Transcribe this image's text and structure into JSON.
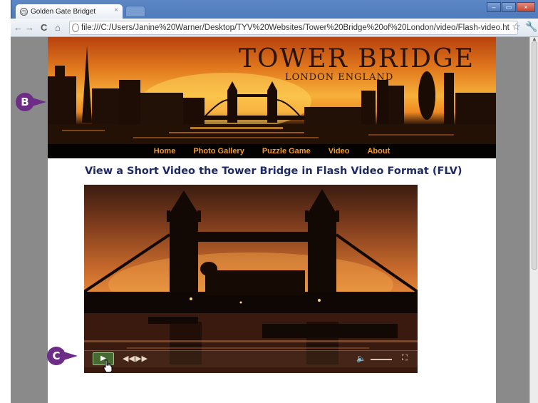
{
  "browser": {
    "tab_title": "Golden Gate Bridget",
    "tab_close": "×",
    "url": "file:///C:/Users/Janine%20Warner/Desktop/TYV%20Websites/Tower%20Bridge%20of%20London/video/Flash-video.ht",
    "window_buttons": {
      "minimize": "–",
      "maximize": "▭",
      "close": "×"
    },
    "icons": {
      "back": "back-arrow-icon",
      "forward": "forward-arrow-icon",
      "reload": "reload-icon",
      "home": "home-icon",
      "bookmark": "star-icon",
      "settings": "wrench-icon"
    }
  },
  "site": {
    "banner_title": "TOWER BRIDGE",
    "banner_subtitle": "LONDON ENGLAND",
    "nav": [
      "Home",
      "Photo Gallery",
      "Puzzle Game",
      "Video",
      "About"
    ],
    "heading": "View a Short Video the Tower Bridge in Flash Video Format (FLV)"
  },
  "video_player": {
    "icons": {
      "play": "play-icon",
      "rewind": "rewind-icon",
      "forward": "fast-forward-icon",
      "volume": "volume-icon",
      "fullscreen": "fullscreen-icon"
    }
  },
  "callouts": {
    "b": "B",
    "c": "C"
  },
  "colors": {
    "callout": "#6d2c86",
    "nav_link": "#f39a2a",
    "heading": "#1e2a66"
  }
}
